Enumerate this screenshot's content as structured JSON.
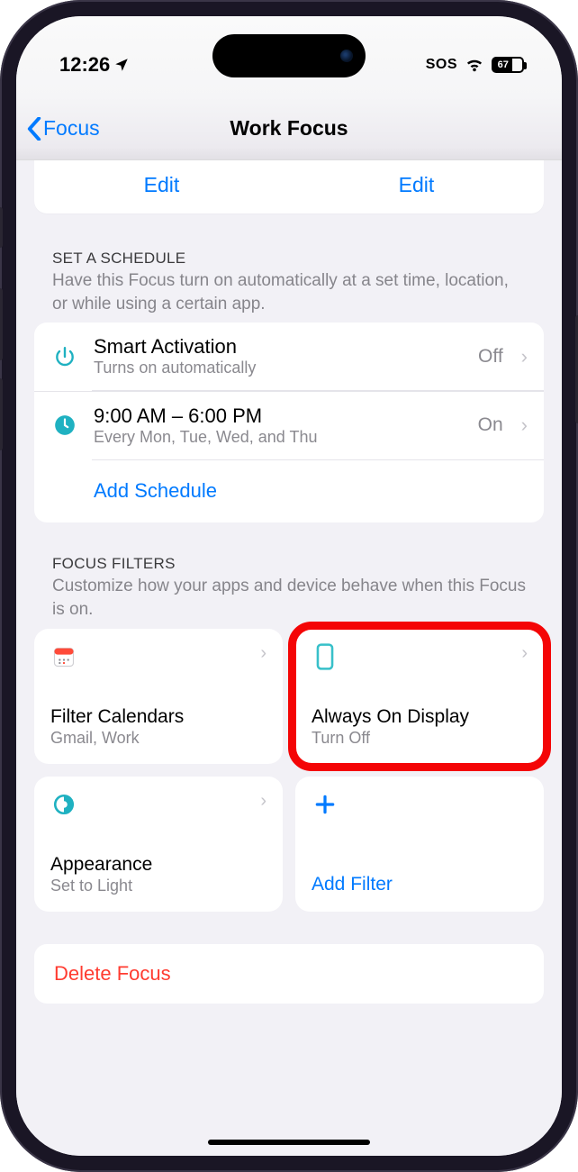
{
  "status": {
    "time": "12:26",
    "sos": "SOS",
    "battery_pct": "67"
  },
  "nav": {
    "back_label": "Focus",
    "title": "Work Focus"
  },
  "peek": {
    "left_edit": "Edit",
    "right_edit": "Edit"
  },
  "schedule": {
    "header": "SET A SCHEDULE",
    "desc": "Have this Focus turn on automatically at a set time, location, or while using a certain app.",
    "rows": [
      {
        "title": "Smart Activation",
        "sub": "Turns on automatically",
        "value": "Off"
      },
      {
        "title": "9:00 AM – 6:00 PM",
        "sub": "Every Mon, Tue, Wed, and Thu",
        "value": "On"
      }
    ],
    "add_label": "Add Schedule"
  },
  "filters": {
    "header": "FOCUS FILTERS",
    "desc": "Customize how your apps and device behave when this Focus is on.",
    "cards": [
      {
        "title": "Filter Calendars",
        "sub": "Gmail, Work"
      },
      {
        "title": "Always On Display",
        "sub": "Turn Off"
      },
      {
        "title": "Appearance",
        "sub": "Set to Light"
      }
    ],
    "add_label": "Add Filter"
  },
  "delete_label": "Delete Focus"
}
